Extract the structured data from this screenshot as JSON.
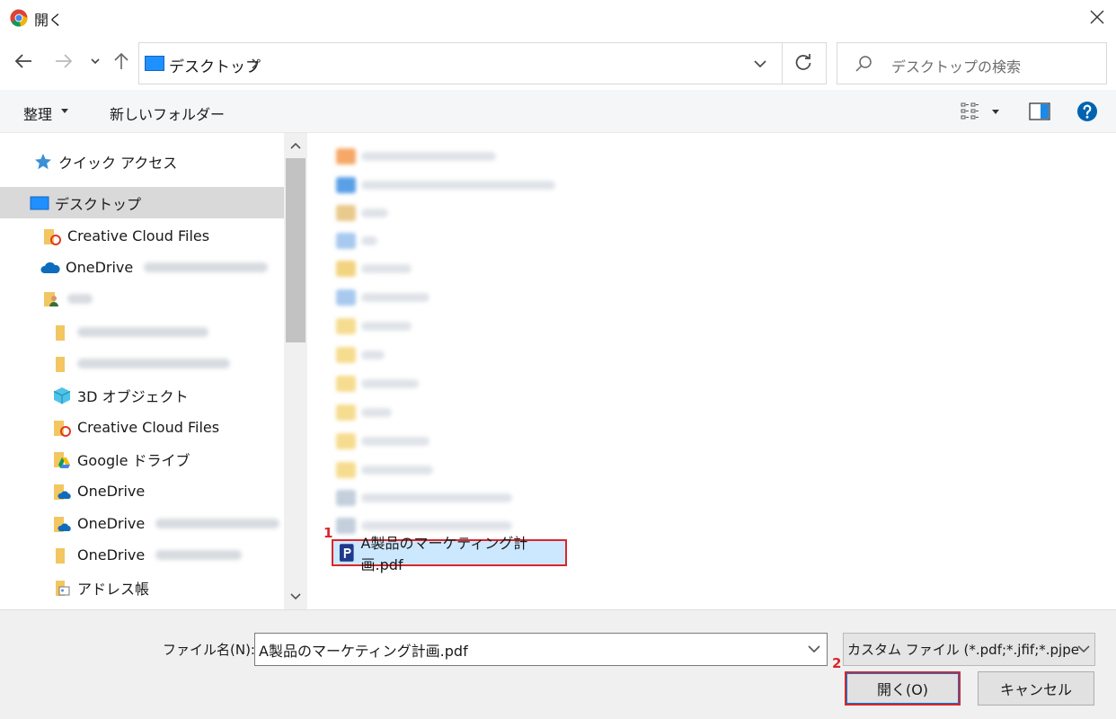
{
  "window": {
    "title": "開く"
  },
  "address": {
    "location": "デスクトップ"
  },
  "search": {
    "placeholder": "デスクトップの検索"
  },
  "command_bar": {
    "organize_label": "整理",
    "new_folder_label": "新しいフォルダー"
  },
  "nav_tree": [
    {
      "label": "クイック アクセス",
      "icon": "star-icon"
    },
    {
      "label": "デスクトップ",
      "icon": "desktop-icon",
      "selected": true
    },
    {
      "label": "Creative Cloud Files",
      "icon": "creative-cloud-folder-icon"
    },
    {
      "label": "OneDrive",
      "icon": "onedrive-cloud-icon"
    },
    {
      "label": "",
      "icon": "user-folder-icon"
    },
    {
      "label": "",
      "icon": "folder-icon"
    },
    {
      "label": "",
      "icon": "folder-icon"
    },
    {
      "label": "3D オブジェクト",
      "icon": "3d-objects-icon"
    },
    {
      "label": "Creative Cloud Files",
      "icon": "creative-cloud-folder-icon"
    },
    {
      "label": "Google ドライブ",
      "icon": "google-drive-folder-icon"
    },
    {
      "label": "OneDrive",
      "icon": "onedrive-folder-icon"
    },
    {
      "label": "OneDrive",
      "icon": "onedrive-folder-icon"
    },
    {
      "label": "OneDrive",
      "icon": "folder-icon"
    },
    {
      "label": "アドレス帳",
      "icon": "contacts-folder-icon"
    }
  ],
  "file_list": {
    "selected_file": "A製品のマーケティング計画.pdf",
    "step1": "1"
  },
  "bottom": {
    "file_name_label": "ファイル名(N):",
    "file_name_value": "A製品のマーケティング計画.pdf",
    "filter_label": "カスタム ファイル (*.pdf;*.jfif;*.pjpe",
    "open_label": "開く(O)",
    "cancel_label": "キャンセル",
    "step2": "2"
  },
  "colors": {
    "accent": "#0078d7",
    "highlight_border": "#d9262b",
    "selection": "#cce8ff"
  }
}
